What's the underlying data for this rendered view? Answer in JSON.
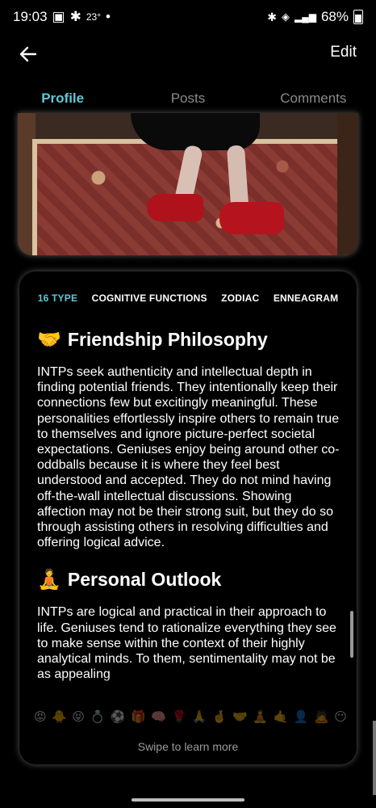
{
  "status": {
    "time": "19:03",
    "temp": "23°",
    "battery": "68%"
  },
  "header": {
    "edit_label": "Edit"
  },
  "tabs": [
    {
      "label": "Profile",
      "active": true
    },
    {
      "label": "Posts",
      "active": false
    },
    {
      "label": "Comments",
      "active": false
    }
  ],
  "sub_tabs": [
    {
      "label": "16 TYPE",
      "active": true
    },
    {
      "label": "COGNITIVE FUNCTIONS",
      "active": false
    },
    {
      "label": "ZODIAC",
      "active": false
    },
    {
      "label": "ENNEAGRAM",
      "active": false
    }
  ],
  "sections": [
    {
      "emoji": "🤝",
      "title": "Friendship Philosophy",
      "body": "INTPs seek authenticity and intellectual depth in finding potential friends. They intentionally keep their connections few but excitingly meaningful. These personalities effortlessly inspire others to remain true to themselves and ignore picture-perfect societal expectations. Geniuses enjoy being around other co-oddballs because it is where they feel best understood and accepted. They do not mind having off-the-wall intellectual discussions. Showing affection may not be their strong suit, but they do so through assisting others in resolving difficulties and offering logical advice."
    },
    {
      "emoji": "🧘",
      "title": "Personal Outlook",
      "body": "INTPs are logical and practical in their approach to life. Geniuses tend to rationalize everything they see to make sense within the context of their highly analytical minds. To them, sentimentality may not be as appealing"
    }
  ],
  "emoji_row": [
    "😡",
    "🐥",
    "😝",
    "💍",
    "⚽",
    "🎁",
    "🧠",
    "🌹",
    "🙏",
    "🤞",
    "🤝",
    "🧘",
    "🤙",
    "👤",
    "🙇",
    "😶"
  ],
  "swipe_hint": "Swipe to learn more",
  "colors": {
    "accent": "#5fc9d4",
    "background": "#000000"
  }
}
